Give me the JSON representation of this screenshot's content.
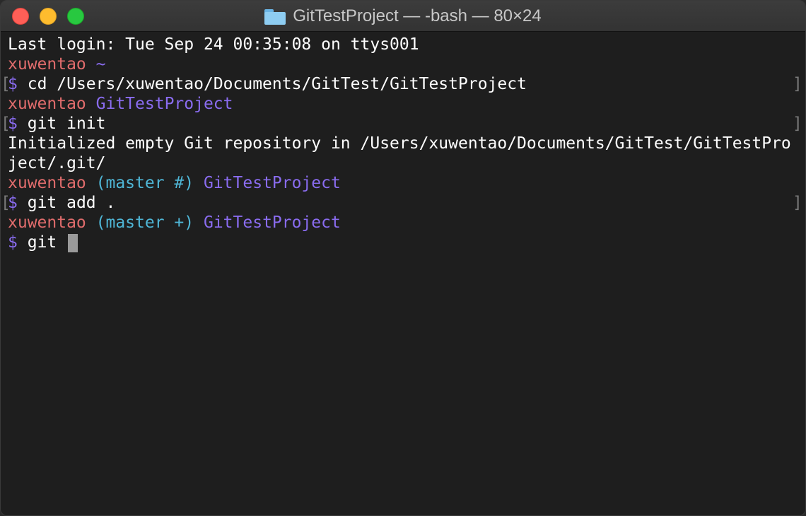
{
  "window": {
    "title": "GitTestProject — -bash — 80×24",
    "folder_icon": "folder-icon"
  },
  "terminal": {
    "last_login": "Last login: Tue Sep 24 00:35:08 on ttys001",
    "prompt1": {
      "user": "xuwentao",
      "path": "~"
    },
    "cmd1": {
      "dollar": "$",
      "text": "cd /Users/xuwentao/Documents/GitTest/GitTestProject"
    },
    "prompt2": {
      "user": "xuwentao",
      "path": "GitTestProject"
    },
    "cmd2": {
      "dollar": "$",
      "text": "git init"
    },
    "output1": "Initialized empty Git repository in /Users/xuwentao/Documents/GitTest/GitTestPro",
    "output2": "ject/.git/",
    "prompt3": {
      "user": "xuwentao",
      "branch": "(master #)",
      "path": "GitTestProject"
    },
    "cmd3": {
      "dollar": "$",
      "text": "git add ."
    },
    "prompt4": {
      "user": "xuwentao",
      "branch": "(master +)",
      "path": "GitTestProject"
    },
    "cmd4": {
      "dollar": "$",
      "text": "git"
    },
    "bracket_left": "[",
    "bracket_right": "]"
  },
  "colors": {
    "user": "#e06c6c",
    "path": "#8a6cf0",
    "branch": "#4fb6d6",
    "background": "#1e1e1e"
  }
}
